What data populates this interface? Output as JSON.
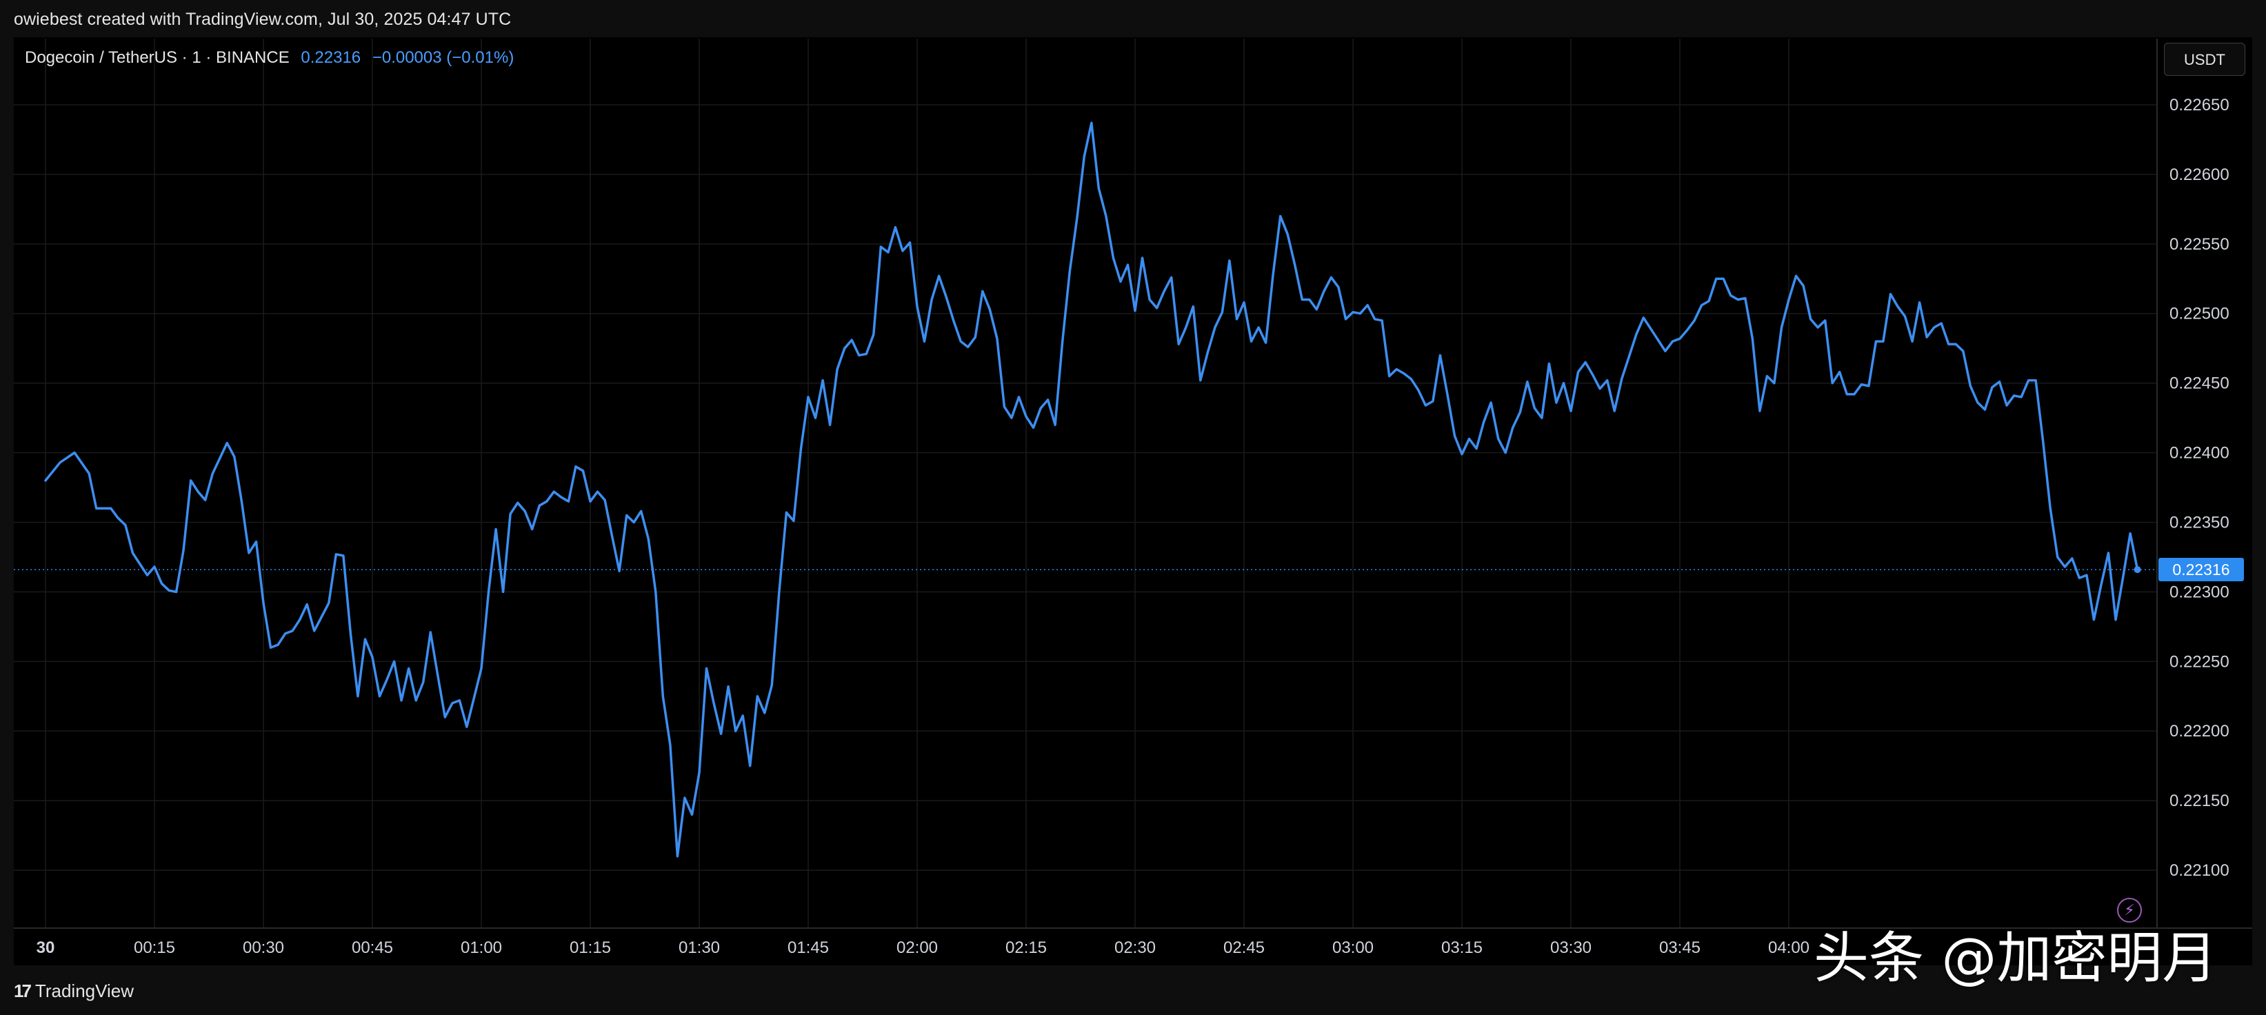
{
  "header": {
    "caption": "owiebest created with TradingView.com, Jul 30, 2025 04:47 UTC"
  },
  "symbol": {
    "name": "Dogecoin / TetherUS · 1 · BINANCE",
    "last": "0.22316",
    "change": "−0.00003 (−0.01%)"
  },
  "currency_button": "USDT",
  "price_tag": "0.22316",
  "footer": {
    "brand_logo": "17",
    "brand_name": "TradingView"
  },
  "watermark": "头条 @加密明月",
  "colors": {
    "line": "#3d8ef0",
    "background": "#000000",
    "grid": "#1a1a1a",
    "accent": "#2d8cf0"
  },
  "icons": [
    "bolt-icon",
    "tradingview-logo-icon"
  ],
  "chart_data": {
    "type": "line",
    "ylim": [
      0.2207,
      0.2268
    ],
    "y_ticks": [
      "0.22650",
      "0.22600",
      "0.22550",
      "0.22500",
      "0.22450",
      "0.22400",
      "0.22350",
      "0.22300",
      "0.22250",
      "0.22200",
      "0.22150",
      "0.22100"
    ],
    "x_ticks": [
      "30",
      "00:15",
      "00:30",
      "00:45",
      "01:00",
      "01:15",
      "01:30",
      "01:45",
      "02:00",
      "02:15",
      "02:30",
      "02:45",
      "03:00",
      "03:15",
      "03:30",
      "03:45",
      "04:00"
    ],
    "x_start": "00:00",
    "x_end": "04:48",
    "grid": true,
    "last_price_line": 0.22316,
    "series": [
      {
        "points": [
          [
            "00:00",
            0.2238
          ],
          [
            "00:02",
            0.22393
          ],
          [
            "00:04",
            0.224
          ],
          [
            "00:06",
            0.22385
          ],
          [
            "00:07",
            0.2236
          ],
          [
            "00:09",
            0.2236
          ],
          [
            "00:10",
            0.22353
          ],
          [
            "00:11",
            0.22348
          ],
          [
            "00:12",
            0.22328
          ],
          [
            "00:13",
            0.2232
          ],
          [
            "00:14",
            0.22312
          ],
          [
            "00:15",
            0.22318
          ],
          [
            "00:16",
            0.22306
          ],
          [
            "00:17",
            0.22301
          ],
          [
            "00:18",
            0.223
          ],
          [
            "00:19",
            0.2233
          ],
          [
            "00:20",
            0.2238
          ],
          [
            "00:21",
            0.22372
          ],
          [
            "00:22",
            0.22366
          ],
          [
            "00:23",
            0.22385
          ],
          [
            "00:25",
            0.22407
          ],
          [
            "00:26",
            0.22397
          ],
          [
            "00:27",
            0.22365
          ],
          [
            "00:28",
            0.22328
          ],
          [
            "00:29",
            0.22336
          ],
          [
            "00:30",
            0.22292
          ],
          [
            "00:31",
            0.2226
          ],
          [
            "00:32",
            0.22262
          ],
          [
            "00:33",
            0.2227
          ],
          [
            "00:34",
            0.22272
          ],
          [
            "00:35",
            0.2228
          ],
          [
            "00:36",
            0.22291
          ],
          [
            "00:37",
            0.22272
          ],
          [
            "00:38",
            0.22282
          ],
          [
            "00:39",
            0.22292
          ],
          [
            "00:40",
            0.22327
          ],
          [
            "00:41",
            0.22326
          ],
          [
            "00:42",
            0.2227
          ],
          [
            "00:43",
            0.22225
          ],
          [
            "00:44",
            0.22266
          ],
          [
            "00:45",
            0.22253
          ],
          [
            "00:46",
            0.22225
          ],
          [
            "00:47",
            0.22237
          ],
          [
            "00:48",
            0.2225
          ],
          [
            "00:49",
            0.22222
          ],
          [
            "00:50",
            0.22245
          ],
          [
            "00:51",
            0.22222
          ],
          [
            "00:52",
            0.22235
          ],
          [
            "00:53",
            0.22271
          ],
          [
            "00:54",
            0.2224
          ],
          [
            "00:55",
            0.2221
          ],
          [
            "00:56",
            0.2222
          ],
          [
            "00:57",
            0.22222
          ],
          [
            "00:58",
            0.22203
          ],
          [
            "00:59",
            0.22224
          ],
          [
            "01:00",
            0.22245
          ],
          [
            "01:01",
            0.223
          ],
          [
            "01:02",
            0.22345
          ],
          [
            "01:03",
            0.223
          ],
          [
            "01:04",
            0.22356
          ],
          [
            "01:05",
            0.22364
          ],
          [
            "01:06",
            0.22358
          ],
          [
            "01:07",
            0.22345
          ],
          [
            "01:08",
            0.22362
          ],
          [
            "01:09",
            0.22365
          ],
          [
            "01:10",
            0.22372
          ],
          [
            "01:11",
            0.22368
          ],
          [
            "01:12",
            0.22365
          ],
          [
            "01:13",
            0.2239
          ],
          [
            "01:14",
            0.22387
          ],
          [
            "01:15",
            0.22365
          ],
          [
            "01:16",
            0.22372
          ],
          [
            "01:17",
            0.22366
          ],
          [
            "01:18",
            0.2234
          ],
          [
            "01:19",
            0.22315
          ],
          [
            "01:20",
            0.22355
          ],
          [
            "01:21",
            0.2235
          ],
          [
            "01:22",
            0.22358
          ],
          [
            "01:23",
            0.22338
          ],
          [
            "01:24",
            0.223
          ],
          [
            "01:25",
            0.22225
          ],
          [
            "01:26",
            0.2219
          ],
          [
            "01:27",
            0.2211
          ],
          [
            "01:28",
            0.22152
          ],
          [
            "01:29",
            0.2214
          ],
          [
            "01:30",
            0.2217
          ],
          [
            "01:31",
            0.22245
          ],
          [
            "01:32",
            0.2222
          ],
          [
            "01:33",
            0.22198
          ],
          [
            "01:34",
            0.22232
          ],
          [
            "01:35",
            0.222
          ],
          [
            "01:36",
            0.22211
          ],
          [
            "01:37",
            0.22175
          ],
          [
            "01:38",
            0.22225
          ],
          [
            "01:39",
            0.22213
          ],
          [
            "01:40",
            0.22233
          ],
          [
            "01:41",
            0.223
          ],
          [
            "01:42",
            0.22357
          ],
          [
            "01:43",
            0.22351
          ],
          [
            "01:44",
            0.22403
          ],
          [
            "01:45",
            0.2244
          ],
          [
            "01:46",
            0.22425
          ],
          [
            "01:47",
            0.22452
          ],
          [
            "01:48",
            0.2242
          ],
          [
            "01:49",
            0.2246
          ],
          [
            "01:50",
            0.22475
          ],
          [
            "01:51",
            0.22481
          ],
          [
            "01:52",
            0.2247
          ],
          [
            "01:53",
            0.22471
          ],
          [
            "01:54",
            0.22485
          ],
          [
            "01:55",
            0.22548
          ],
          [
            "01:56",
            0.22544
          ],
          [
            "01:57",
            0.22562
          ],
          [
            "01:58",
            0.22545
          ],
          [
            "01:59",
            0.22551
          ],
          [
            "02:00",
            0.22505
          ],
          [
            "02:01",
            0.2248
          ],
          [
            "02:02",
            0.2251
          ],
          [
            "02:03",
            0.22527
          ],
          [
            "02:04",
            0.22512
          ],
          [
            "02:05",
            0.22495
          ],
          [
            "02:06",
            0.2248
          ],
          [
            "02:07",
            0.22476
          ],
          [
            "02:08",
            0.22483
          ],
          [
            "02:09",
            0.22516
          ],
          [
            "02:10",
            0.22503
          ],
          [
            "02:11",
            0.22482
          ],
          [
            "02:12",
            0.22433
          ],
          [
            "02:13",
            0.22425
          ],
          [
            "02:14",
            0.2244
          ],
          [
            "02:15",
            0.22426
          ],
          [
            "02:16",
            0.22418
          ],
          [
            "02:17",
            0.22432
          ],
          [
            "02:18",
            0.22438
          ],
          [
            "02:19",
            0.2242
          ],
          [
            "02:20",
            0.2248
          ],
          [
            "02:21",
            0.2253
          ],
          [
            "02:22",
            0.22568
          ],
          [
            "02:23",
            0.22613
          ],
          [
            "02:24",
            0.22637
          ],
          [
            "02:25",
            0.2259
          ],
          [
            "02:26",
            0.2257
          ],
          [
            "02:27",
            0.2254
          ],
          [
            "02:28",
            0.22523
          ],
          [
            "02:29",
            0.22535
          ],
          [
            "02:30",
            0.22502
          ],
          [
            "02:31",
            0.2254
          ],
          [
            "02:32",
            0.2251
          ],
          [
            "02:33",
            0.22504
          ],
          [
            "02:34",
            0.22516
          ],
          [
            "02:35",
            0.22526
          ],
          [
            "02:36",
            0.22478
          ],
          [
            "02:37",
            0.2249
          ],
          [
            "02:38",
            0.22505
          ],
          [
            "02:39",
            0.22452
          ],
          [
            "02:40",
            0.22472
          ],
          [
            "02:41",
            0.2249
          ],
          [
            "02:42",
            0.22501
          ],
          [
            "02:43",
            0.22538
          ],
          [
            "02:44",
            0.22496
          ],
          [
            "02:45",
            0.22508
          ],
          [
            "02:46",
            0.2248
          ],
          [
            "02:47",
            0.2249
          ],
          [
            "02:48",
            0.22479
          ],
          [
            "02:49",
            0.22528
          ],
          [
            "02:50",
            0.2257
          ],
          [
            "02:51",
            0.22557
          ],
          [
            "02:52",
            0.22535
          ],
          [
            "02:53",
            0.2251
          ],
          [
            "02:54",
            0.2251
          ],
          [
            "02:55",
            0.22503
          ],
          [
            "02:56",
            0.22516
          ],
          [
            "02:57",
            0.22526
          ],
          [
            "02:58",
            0.22519
          ],
          [
            "02:59",
            0.22496
          ],
          [
            "03:00",
            0.22501
          ],
          [
            "03:01",
            0.225
          ],
          [
            "03:02",
            0.22506
          ],
          [
            "03:03",
            0.22496
          ],
          [
            "03:04",
            0.22495
          ],
          [
            "03:05",
            0.22455
          ],
          [
            "03:06",
            0.2246
          ],
          [
            "03:07",
            0.22457
          ],
          [
            "03:08",
            0.22453
          ],
          [
            "03:09",
            0.22445
          ],
          [
            "03:10",
            0.22434
          ],
          [
            "03:11",
            0.22437
          ],
          [
            "03:12",
            0.2247
          ],
          [
            "03:13",
            0.22442
          ],
          [
            "03:14",
            0.22412
          ],
          [
            "03:15",
            0.22399
          ],
          [
            "03:16",
            0.2241
          ],
          [
            "03:17",
            0.22403
          ],
          [
            "03:18",
            0.22422
          ],
          [
            "03:19",
            0.22436
          ],
          [
            "03:20",
            0.2241
          ],
          [
            "03:21",
            0.224
          ],
          [
            "03:22",
            0.22418
          ],
          [
            "03:23",
            0.22429
          ],
          [
            "03:24",
            0.22451
          ],
          [
            "03:25",
            0.22432
          ],
          [
            "03:26",
            0.22425
          ],
          [
            "03:27",
            0.22464
          ],
          [
            "03:28",
            0.22436
          ],
          [
            "03:29",
            0.2245
          ],
          [
            "03:30",
            0.2243
          ],
          [
            "03:31",
            0.22458
          ],
          [
            "03:32",
            0.22465
          ],
          [
            "03:33",
            0.22456
          ],
          [
            "03:34",
            0.22446
          ],
          [
            "03:35",
            0.22452
          ],
          [
            "03:36",
            0.2243
          ],
          [
            "03:37",
            0.22453
          ],
          [
            "03:38",
            0.22469
          ],
          [
            "03:39",
            0.22485
          ],
          [
            "03:40",
            0.22497
          ],
          [
            "03:41",
            0.22489
          ],
          [
            "03:42",
            0.22481
          ],
          [
            "03:43",
            0.22473
          ],
          [
            "03:44",
            0.2248
          ],
          [
            "03:45",
            0.22482
          ],
          [
            "03:46",
            0.22488
          ],
          [
            "03:47",
            0.22495
          ],
          [
            "03:48",
            0.22506
          ],
          [
            "03:49",
            0.22509
          ],
          [
            "03:50",
            0.22525
          ],
          [
            "03:51",
            0.22525
          ],
          [
            "03:52",
            0.22513
          ],
          [
            "03:53",
            0.2251
          ],
          [
            "03:54",
            0.22511
          ],
          [
            "03:55",
            0.22482
          ],
          [
            "03:56",
            0.2243
          ],
          [
            "03:57",
            0.22455
          ],
          [
            "03:58",
            0.2245
          ],
          [
            "03:59",
            0.2249
          ],
          [
            "04:00",
            0.2251
          ],
          [
            "04:01",
            0.22527
          ],
          [
            "04:02",
            0.2252
          ],
          [
            "04:03",
            0.22496
          ],
          [
            "04:04",
            0.2249
          ],
          [
            "04:05",
            0.22495
          ],
          [
            "04:06",
            0.2245
          ],
          [
            "04:07",
            0.22458
          ],
          [
            "04:08",
            0.22442
          ],
          [
            "04:09",
            0.22442
          ],
          [
            "04:10",
            0.22449
          ],
          [
            "04:11",
            0.22448
          ],
          [
            "04:12",
            0.2248
          ],
          [
            "04:13",
            0.2248
          ],
          [
            "04:14",
            0.22514
          ],
          [
            "04:15",
            0.22505
          ],
          [
            "04:16",
            0.22498
          ],
          [
            "04:17",
            0.2248
          ],
          [
            "04:18",
            0.22508
          ],
          [
            "04:19",
            0.22483
          ],
          [
            "04:20",
            0.2249
          ],
          [
            "04:21",
            0.22493
          ],
          [
            "04:22",
            0.22478
          ],
          [
            "04:23",
            0.22478
          ],
          [
            "04:24",
            0.22473
          ],
          [
            "04:25",
            0.22448
          ],
          [
            "04:26",
            0.22436
          ],
          [
            "04:27",
            0.22431
          ],
          [
            "04:28",
            0.22447
          ],
          [
            "04:29",
            0.22451
          ],
          [
            "04:30",
            0.22434
          ],
          [
            "04:31",
            0.22441
          ],
          [
            "04:32",
            0.2244
          ],
          [
            "04:33",
            0.22452
          ],
          [
            "04:34",
            0.22452
          ],
          [
            "04:35",
            0.22408
          ],
          [
            "04:36",
            0.2236
          ],
          [
            "04:37",
            0.22325
          ],
          [
            "04:38",
            0.22318
          ],
          [
            "04:39",
            0.22324
          ],
          [
            "04:40",
            0.2231
          ],
          [
            "04:41",
            0.22312
          ],
          [
            "04:42",
            0.2228
          ],
          [
            "04:43",
            0.22305
          ],
          [
            "04:44",
            0.22328
          ],
          [
            "04:45",
            0.2228
          ],
          [
            "04:46",
            0.2231
          ],
          [
            "04:47",
            0.22342
          ],
          [
            "04:48",
            0.22316
          ]
        ]
      }
    ]
  }
}
